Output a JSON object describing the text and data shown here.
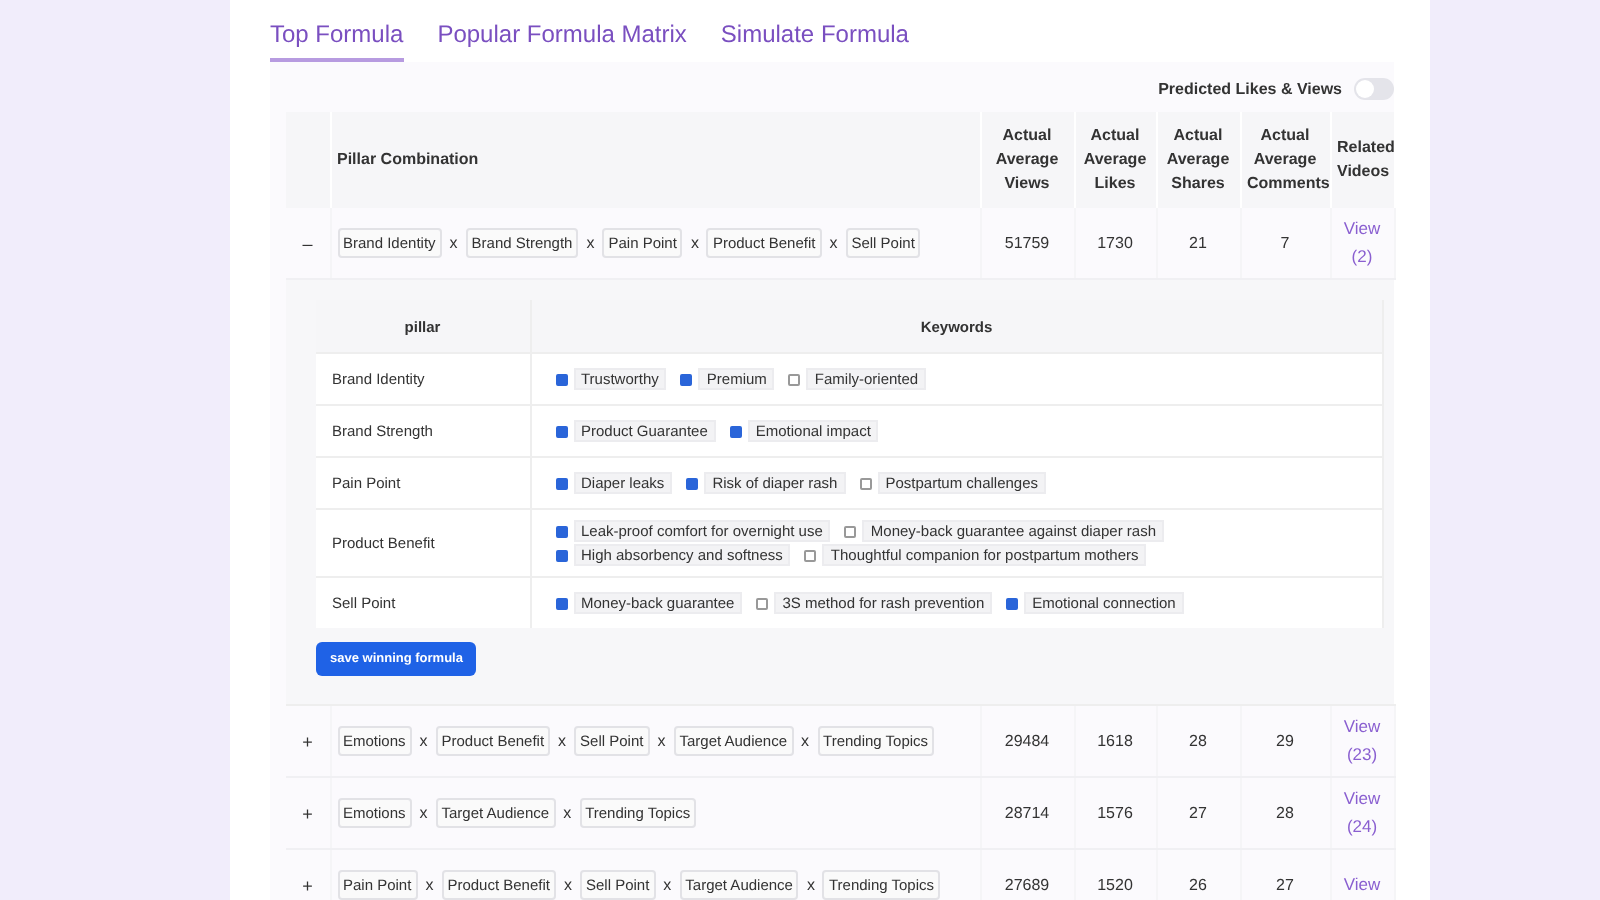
{
  "tabs": [
    {
      "label": "Top Formula",
      "selected": true
    },
    {
      "label": "Popular Formula Matrix",
      "selected": false
    },
    {
      "label": "Simulate Formula",
      "selected": false
    }
  ],
  "toggle": {
    "label": "Predicted Likes & Views",
    "on": false
  },
  "table": {
    "columns": [
      "",
      "Pillar Combination",
      "Actual Average Views",
      "Actual Average Likes",
      "Actual Average Shares",
      "Actual Average Comments",
      "Related Videos"
    ],
    "rows": [
      {
        "toggle": "–",
        "pillars": [
          {
            "label": "Brand Identity"
          },
          {
            "joiner": "x",
            "label": "Brand Strength"
          },
          {
            "joiner": "x",
            "label": "Pain Point"
          },
          {
            "joiner": "x",
            "label": "Product Benefit"
          },
          {
            "joiner": "x",
            "label": "Sell Point"
          }
        ],
        "views": "51759",
        "likes": "1730",
        "shares": "21",
        "comments": "7",
        "videos": "View (2)",
        "detail": {
          "columns": [
            "pillar",
            "Keywords"
          ],
          "button": "save winning formula",
          "rows": [
            {
              "pillar": "Brand Identity",
              "lines": [
                [
                  {
                    "label": "Trustworthy",
                    "checked": true
                  },
                  {
                    "label": "Premium",
                    "checked": true
                  },
                  {
                    "label": "Family-oriented",
                    "checked": false
                  }
                ]
              ]
            },
            {
              "pillar": "Brand Strength",
              "lines": [
                [
                  {
                    "label": "Product Guarantee",
                    "checked": true
                  },
                  {
                    "label": "Emotional impact",
                    "checked": true
                  }
                ]
              ]
            },
            {
              "pillar": "Pain Point",
              "lines": [
                [
                  {
                    "label": "Diaper leaks",
                    "checked": true
                  },
                  {
                    "label": "Risk of diaper rash",
                    "checked": true
                  },
                  {
                    "label": "Postpartum challenges",
                    "checked": false
                  }
                ]
              ]
            },
            {
              "pillar": "Product Benefit",
              "lines": [
                [
                  {
                    "label": "Leak-proof comfort for overnight use",
                    "checked": true
                  },
                  {
                    "label": "Money-back guarantee against diaper rash",
                    "checked": false
                  }
                ],
                [
                  {
                    "label": "High absorbency and softness",
                    "checked": true
                  },
                  {
                    "label": "Thoughtful companion for postpartum mothers",
                    "checked": false
                  }
                ]
              ]
            },
            {
              "pillar": "Sell Point",
              "lines": [
                [
                  {
                    "label": "Money-back guarantee",
                    "checked": true
                  },
                  {
                    "label": "3S method for rash prevention",
                    "checked": false
                  },
                  {
                    "label": "Emotional connection",
                    "checked": true
                  }
                ]
              ]
            }
          ]
        }
      },
      {
        "toggle": "+",
        "pillars": [
          {
            "label": "Emotions"
          },
          {
            "joiner": "x",
            "label": "Product Benefit"
          },
          {
            "joiner": "x",
            "label": "Sell Point"
          },
          {
            "joiner": "x",
            "label": "Target Audience"
          },
          {
            "joiner": "x",
            "label": "Trending Topics"
          }
        ],
        "views": "29484",
        "likes": "1618",
        "shares": "28",
        "comments": "29",
        "videos": "View (23)"
      },
      {
        "toggle": "+",
        "pillars": [
          {
            "label": "Emotions"
          },
          {
            "joiner": "x",
            "label": "Target Audience"
          },
          {
            "joiner": "x",
            "label": "Trending Topics"
          }
        ],
        "views": "28714",
        "likes": "1576",
        "shares": "27",
        "comments": "28",
        "videos": "View (24)"
      },
      {
        "toggle": "+",
        "pillars": [
          {
            "label": "Pain Point"
          },
          {
            "joiner": "x",
            "label": "Product Benefit"
          },
          {
            "joiner": "x",
            "label": "Sell Point"
          },
          {
            "joiner": "x",
            "label": "Target Audience"
          },
          {
            "joiner": "x",
            "label": "Trending Topics"
          }
        ],
        "views": "27689",
        "likes": "1520",
        "shares": "26",
        "comments": "27",
        "videos": "View"
      }
    ]
  }
}
